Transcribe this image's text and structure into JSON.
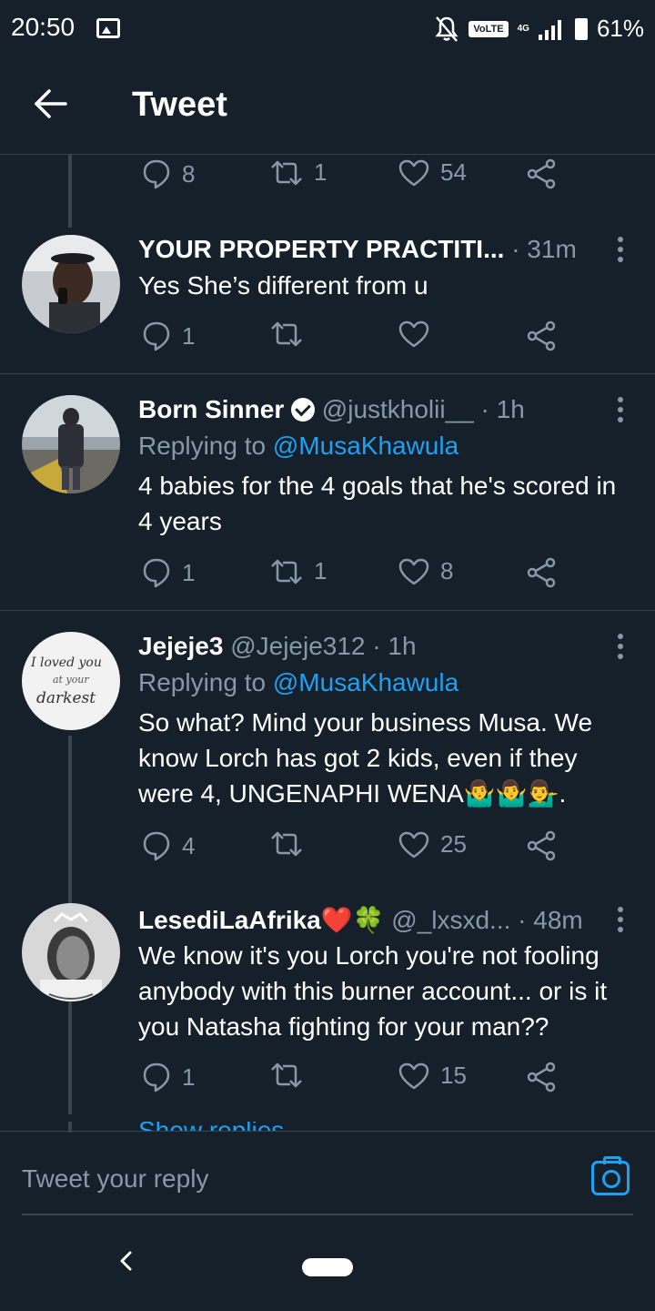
{
  "status_bar": {
    "time": "20:50",
    "network_label": "VoLTE",
    "network_type": "4G",
    "battery_percent": "61%"
  },
  "header": {
    "title": "Tweet"
  },
  "tweets": [
    {
      "actions": {
        "replies": "8",
        "retweets": "1",
        "likes": "54"
      }
    },
    {
      "name": "YOUR PROPERTY PRACTITI...",
      "meta": " · 31m",
      "body": "Yes She’s different from u",
      "actions": {
        "replies": "1",
        "retweets": "",
        "likes": ""
      }
    },
    {
      "name": "Born Sinner",
      "meta": " @justkholii__ · 1h",
      "replying_prefix": "Replying to ",
      "replying_to": "@MusaKhawula",
      "body": "4 babies for the 4 goals that he's scored in 4 years",
      "actions": {
        "replies": "1",
        "retweets": "1",
        "likes": "8"
      }
    },
    {
      "name": "Jejeje3",
      "meta": " @Jejeje312 · 1h",
      "replying_prefix": "Replying to ",
      "replying_to": "@MusaKhawula",
      "body": "So what? Mind your business Musa. We know Lorch has got 2 kids, even if they were 4, UNGENAPHI WENA🤷‍♂️🤷‍♂️💁‍♂️.",
      "actions": {
        "replies": "4",
        "retweets": "",
        "likes": "25"
      }
    },
    {
      "name": "LesediLaAfrika❤️🍀",
      "meta": " @_lxsxd... · 48m",
      "body": "We know it's you Lorch you're not fooling anybody with this burner account... or is it you Natasha fighting for your man??",
      "actions": {
        "replies": "1",
        "retweets": "",
        "likes": "15"
      }
    }
  ],
  "show_more": "Show replies",
  "reply_box": {
    "placeholder": "Tweet your reply"
  },
  "colors": {
    "background": "#15202b",
    "accent": "#1da1f2",
    "muted": "#8899a6",
    "divider": "#38444d"
  }
}
